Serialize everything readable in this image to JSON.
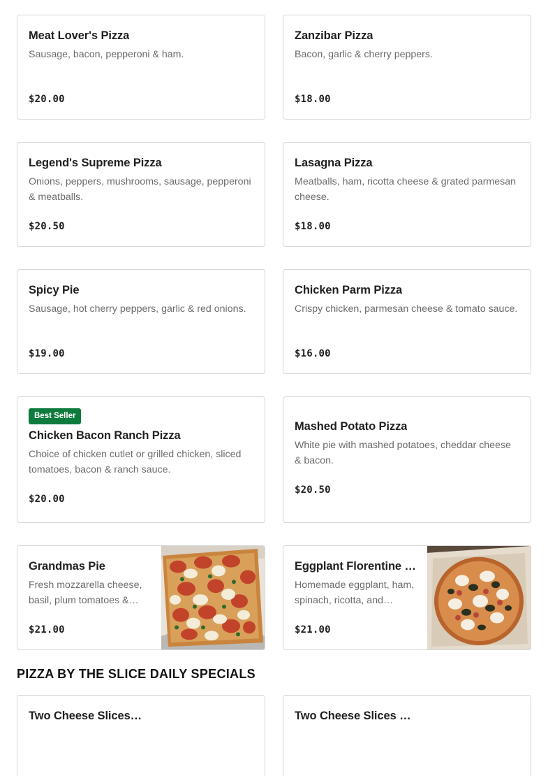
{
  "menu": {
    "items": [
      {
        "name": "Meat Lover's Pizza",
        "desc": "Sausage, bacon, pepperoni & ham.",
        "price": "$20.00"
      },
      {
        "name": "Zanzibar Pizza",
        "desc": "Bacon, garlic & cherry peppers.",
        "price": "$18.00"
      },
      {
        "name": "Legend's Supreme Pizza",
        "desc": "Onions, peppers, mushrooms, sausage, pepperoni & meatballs.",
        "price": "$20.50"
      },
      {
        "name": "Lasagna Pizza",
        "desc": "Meatballs, ham, ricotta cheese & grated parmesan cheese.",
        "price": "$18.00"
      },
      {
        "name": "Spicy Pie",
        "desc": "Sausage, hot cherry peppers, garlic & red onions.",
        "price": "$19.00"
      },
      {
        "name": "Chicken Parm Pizza",
        "desc": "Crispy chicken, parmesan cheese & tomato sauce.",
        "price": "$16.00"
      },
      {
        "name": "Chicken Bacon Ranch Pizza",
        "desc": "Choice of chicken cutlet or grilled chicken, sliced tomatoes, bacon & ranch sauce.",
        "price": "$20.00",
        "badge": "Best Seller"
      },
      {
        "name": "Mashed Potato Pizza",
        "desc": "White pie with mashed potatoes, cheddar cheese & bacon.",
        "price": "$20.50"
      },
      {
        "name": "Grandmas Pie",
        "desc": "Fresh mozzarella cheese, basil, plum tomatoes & olive oil.",
        "price": "$21.00"
      },
      {
        "name": "Eggplant Florentine Pizza",
        "desc": "Homemade eggplant, ham, spinach, ricotta, and parmesan cheese.",
        "price": "$21.00"
      }
    ]
  },
  "section": {
    "title": "PIZZA BY THE SLICE DAILY SPECIALS",
    "items": [
      {
        "name": "Two Cheese Slices & Soda"
      },
      {
        "name": "Two Cheese Slices with Soda"
      }
    ]
  },
  "colors": {
    "badge_bg": "#0d7a3e",
    "card_border": "#d6d6d6",
    "description": "#6b6b6b"
  },
  "icons": {
    "grandmas_pie_photo": "square-pizza-photo",
    "eggplant_photo": "round-pizza-in-box-photo"
  }
}
